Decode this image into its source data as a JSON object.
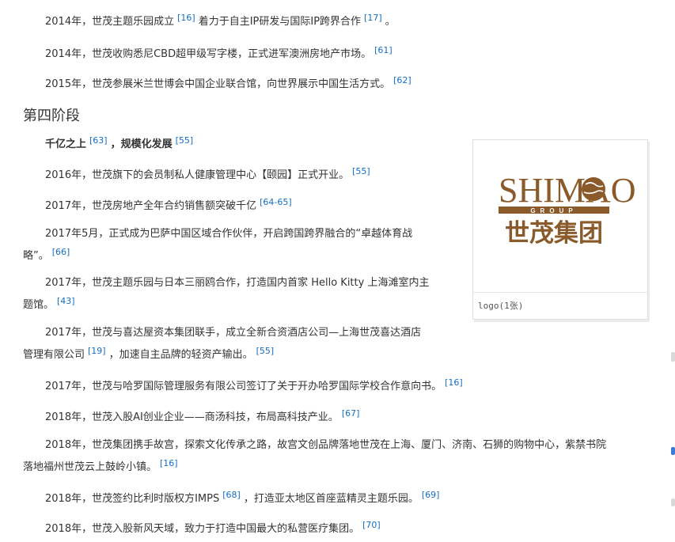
{
  "paragraphs": [
    {
      "text": "2014年，世茂主题乐园成立",
      "ref1": "[16]",
      "text2": "着力于自主IP研发与国际IP跨界合作",
      "ref2": "[17]",
      "text3": "。"
    },
    {
      "text": "2014年，世茂收购悉尼CBD超甲级写字楼，正式进军澳洲房地产市场。",
      "ref1": "[61]"
    },
    {
      "text": "2015年，世茂参展米兰世博会中国企业联合馆，向世界展示中国生活方式。",
      "ref1": "[62]"
    }
  ],
  "section_heading": "第四阶段",
  "subheading": {
    "text": "千亿之上",
    "ref1": "[63]",
    "text2": "，规模化发展",
    "ref2": "[55]"
  },
  "stage4": [
    {
      "text": "2016年，世茂旗下的会员制私人健康管理中心【颐园】正式开业。",
      "ref": "[55]"
    },
    {
      "text": "2017年，世茂房地产全年合约销售额突破千亿",
      "ref": "[64-65]"
    },
    {
      "line1": "2017年5月，正式成为巴萨中国区域合作伙伴，开启跨国跨界融合的“卓越体育战",
      "line2": "略”。",
      "ref": "[66]"
    },
    {
      "line1": "2017年，世茂主题乐园与日本三丽鸥合作，打造国内首家 Hello Kitty 上海滩室内主",
      "line2": "题馆。",
      "ref": "[43]"
    },
    {
      "line1": "2017年，世茂与喜达屋资本集团联手，成立全新合资酒店公司—上海世茂喜达酒店",
      "line2": "管理有限公司",
      "ref": "[19]",
      "line2b": "，加速自主品牌的轻资产输出。",
      "ref2": "[55]"
    },
    {
      "text": "2017年，世茂与哈罗国际管理服务有限公司签订了关于开办哈罗国际学校合作意向书。",
      "ref": "[16]"
    },
    {
      "text": "2018年，世茂入股AI创业企业——商汤科技，布局高科技产业。",
      "ref": "[67]"
    },
    {
      "line1": "2018年，世茂集团携手故宫，探索文化传承之路，故宫文创品牌落地世茂在上海、厦门、济南、石狮的购物中心，紫禁书院",
      "line2": "落地福州世茂云上鼓岭小镇。",
      "ref": "[16]"
    },
    {
      "text": "2018年，世茂签约比利时版权方IMPS",
      "ref": "[68]",
      "text2": "，打造亚太地区首座蓝精灵主题乐园。",
      "ref2": "[69]"
    },
    {
      "text": "2018年，世茂入股新风天域，致力于打造中国最大的私营医疗集团。",
      "ref": "[70]"
    }
  ],
  "logo_card": {
    "brand_text": "SHIMAO",
    "group_text": "GROUP",
    "chinese_text": "世茂集团",
    "caption": "logo(1张)",
    "brand_color": "#8b5a2b"
  }
}
